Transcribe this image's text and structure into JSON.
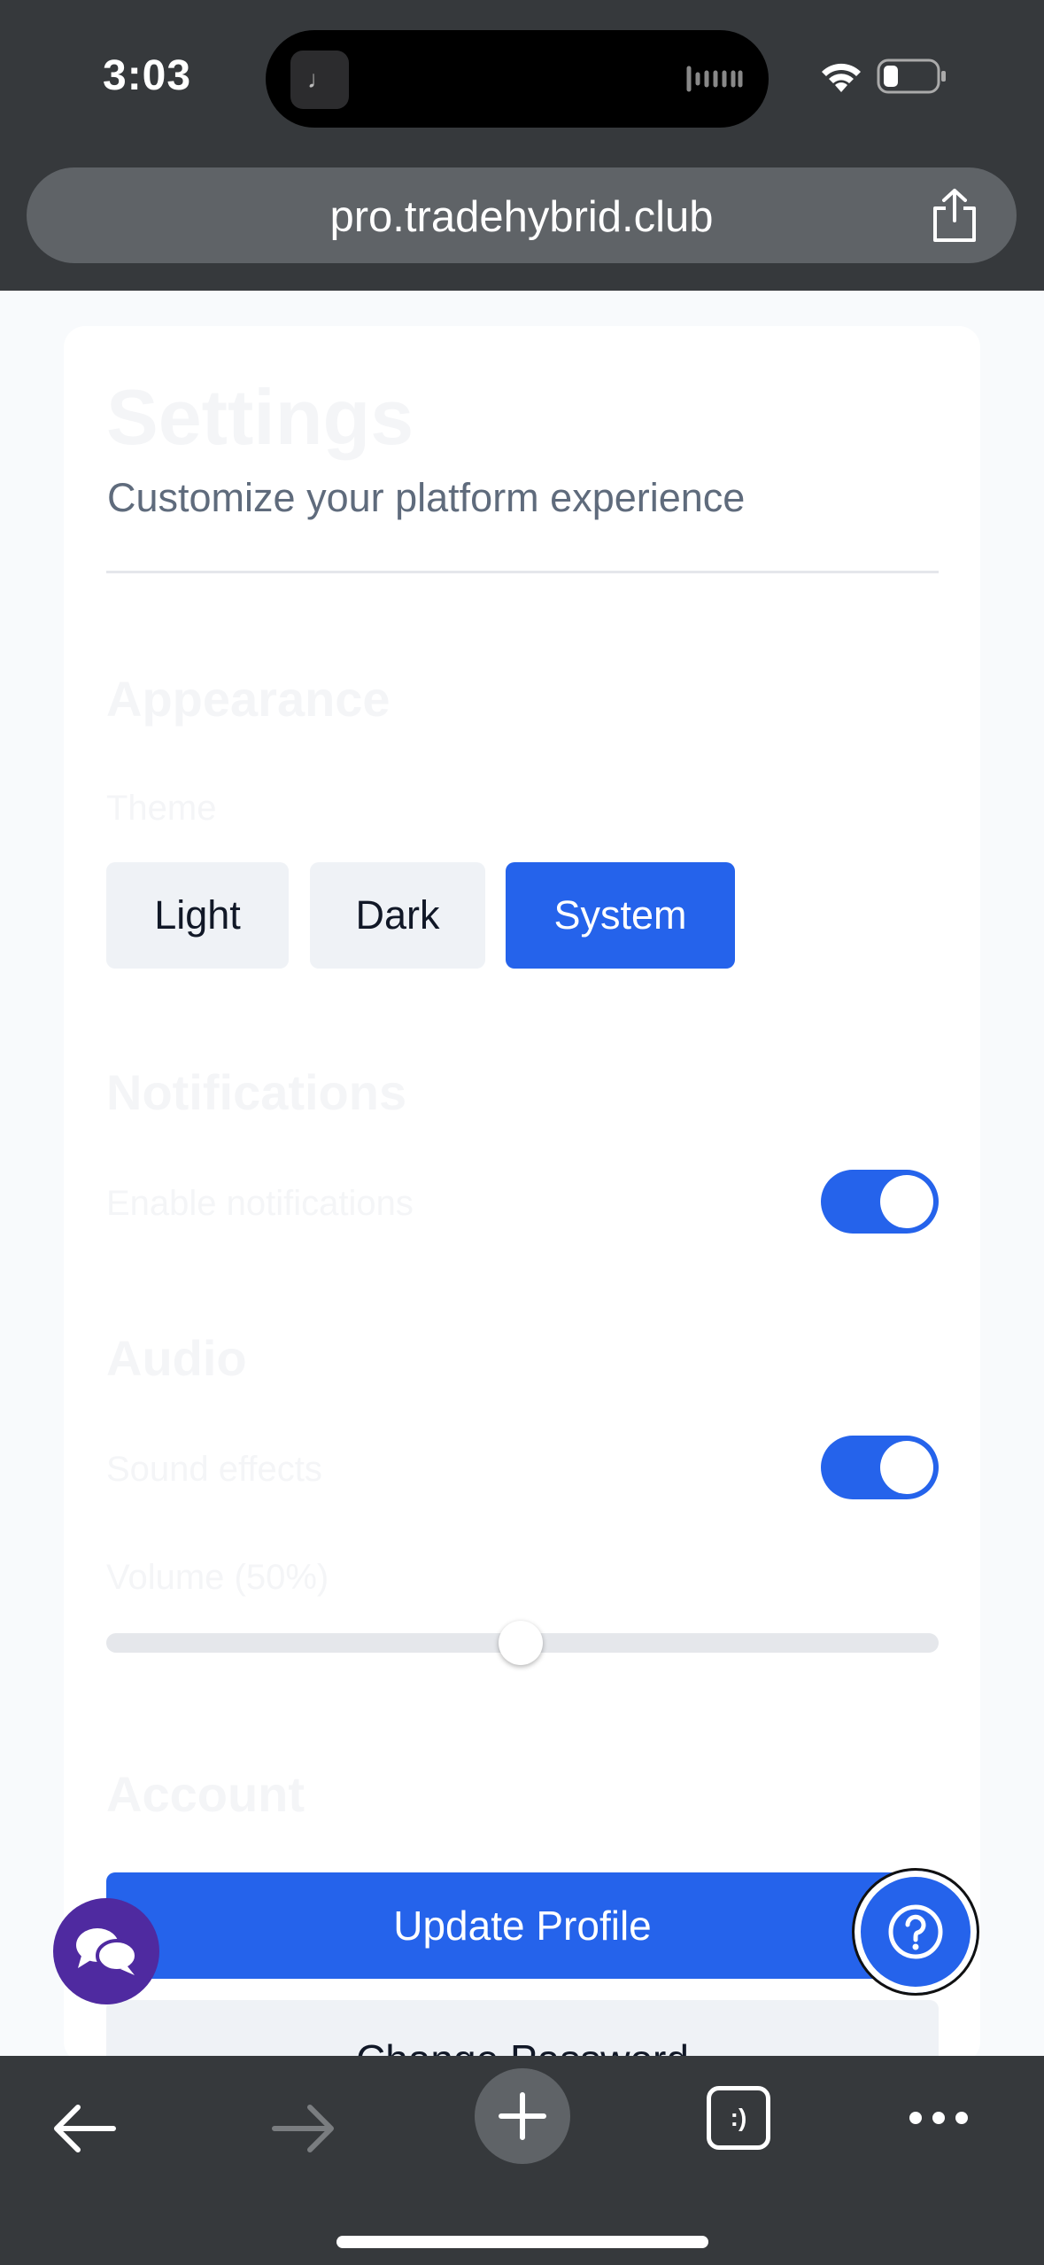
{
  "status_bar": {
    "time": "3:03",
    "island_app_glyph": "♩"
  },
  "browser": {
    "url": "pro.tradehybrid.club"
  },
  "settings": {
    "title": "Settings",
    "subtitle": "Customize your platform experience",
    "appearance": {
      "heading": "Appearance",
      "theme_label": "Theme",
      "theme_options": [
        "Light",
        "Dark",
        "System"
      ],
      "selected_theme": "System"
    },
    "notifications": {
      "heading": "Notifications",
      "enable_label": "Enable notifications",
      "enabled": true
    },
    "audio": {
      "heading": "Audio",
      "sound_effects_label": "Sound effects",
      "sound_effects_enabled": true,
      "volume_label": "Volume (50%)",
      "volume_value": 0.5
    },
    "account": {
      "heading": "Account",
      "update_profile_label": "Update Profile",
      "change_password_label": "Change Password"
    }
  },
  "bottom_toolbar": {
    "tabs_glyph": ":)"
  },
  "colors": {
    "accent": "#2563eb",
    "chrome": "#36393c",
    "chat_fab": "#4f2aa0",
    "muted_heading": "#f4f5f7"
  }
}
